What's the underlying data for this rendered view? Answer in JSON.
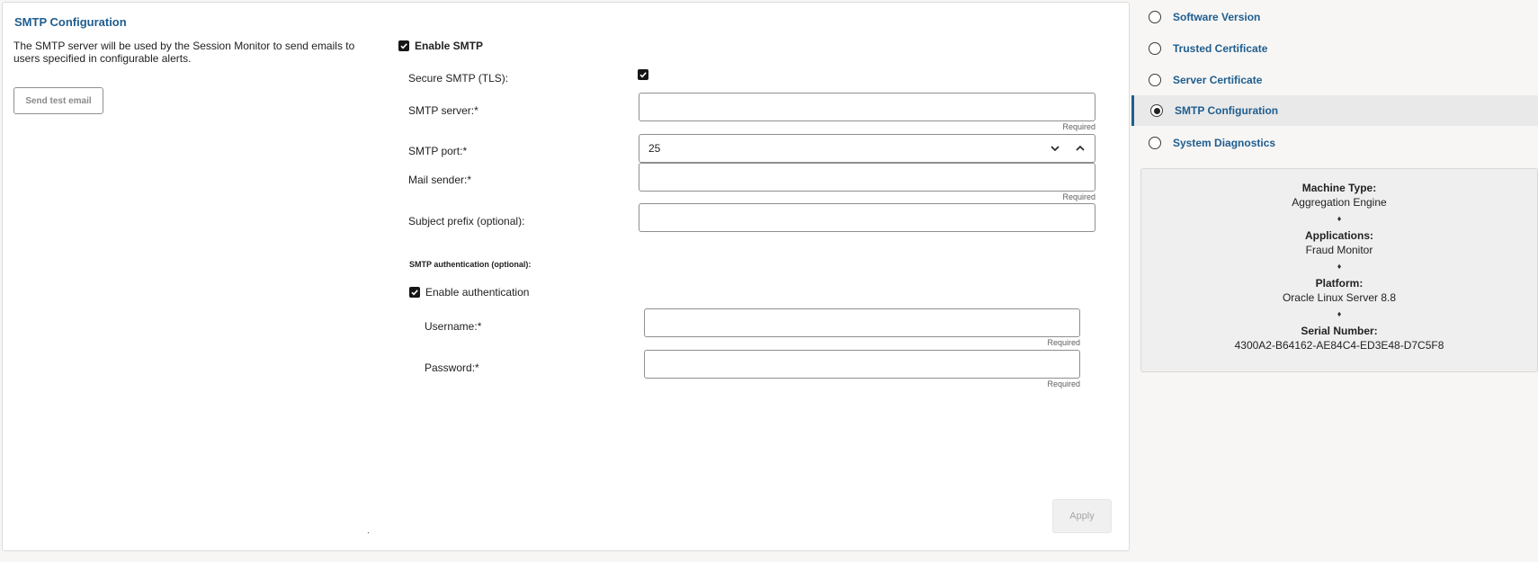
{
  "panel": {
    "title": "SMTP Configuration",
    "description": "The SMTP server will be used by the Session Monitor to send emails to users specified in configurable alerts.",
    "send_test_label": "Send test email",
    "apply_label": "Apply",
    "dot": "."
  },
  "form": {
    "enable_smtp_label": "Enable SMTP",
    "enable_smtp_checked": true,
    "secure_label": "Secure SMTP (TLS):",
    "secure_checked": true,
    "server_label": "SMTP server:*",
    "server_value": "",
    "server_hint": "Required",
    "port_label": "SMTP port:*",
    "port_value": "25",
    "sender_label": "Mail sender:*",
    "sender_value": "",
    "sender_hint": "Required",
    "subject_label": "Subject prefix (optional):",
    "subject_value": "",
    "auth_heading": "SMTP authentication (optional):",
    "enable_auth_label": "Enable authentication",
    "enable_auth_checked": true,
    "username_label": "Username:*",
    "username_value": "",
    "username_hint": "Required",
    "password_label": "Password:*",
    "password_value": "",
    "password_hint": "Required"
  },
  "nav": {
    "items": [
      {
        "label": "Software Version",
        "selected": false
      },
      {
        "label": "Trusted Certificate",
        "selected": false
      },
      {
        "label": "Server Certificate",
        "selected": false
      },
      {
        "label": "SMTP Configuration",
        "selected": true
      },
      {
        "label": "System Diagnostics",
        "selected": false
      }
    ]
  },
  "info": {
    "machine_type_label": "Machine Type:",
    "machine_type": "Aggregation Engine",
    "applications_label": "Applications:",
    "applications": "Fraud Monitor",
    "platform_label": "Platform:",
    "platform": "Oracle Linux Server 8.8",
    "serial_label": "Serial Number:",
    "serial": "4300A2-B64162-AE84C4-ED3E48-D7C5F8",
    "separator": "♦"
  },
  "colors": {
    "accent": "#1f5d8f",
    "checkbox": "#161616"
  }
}
